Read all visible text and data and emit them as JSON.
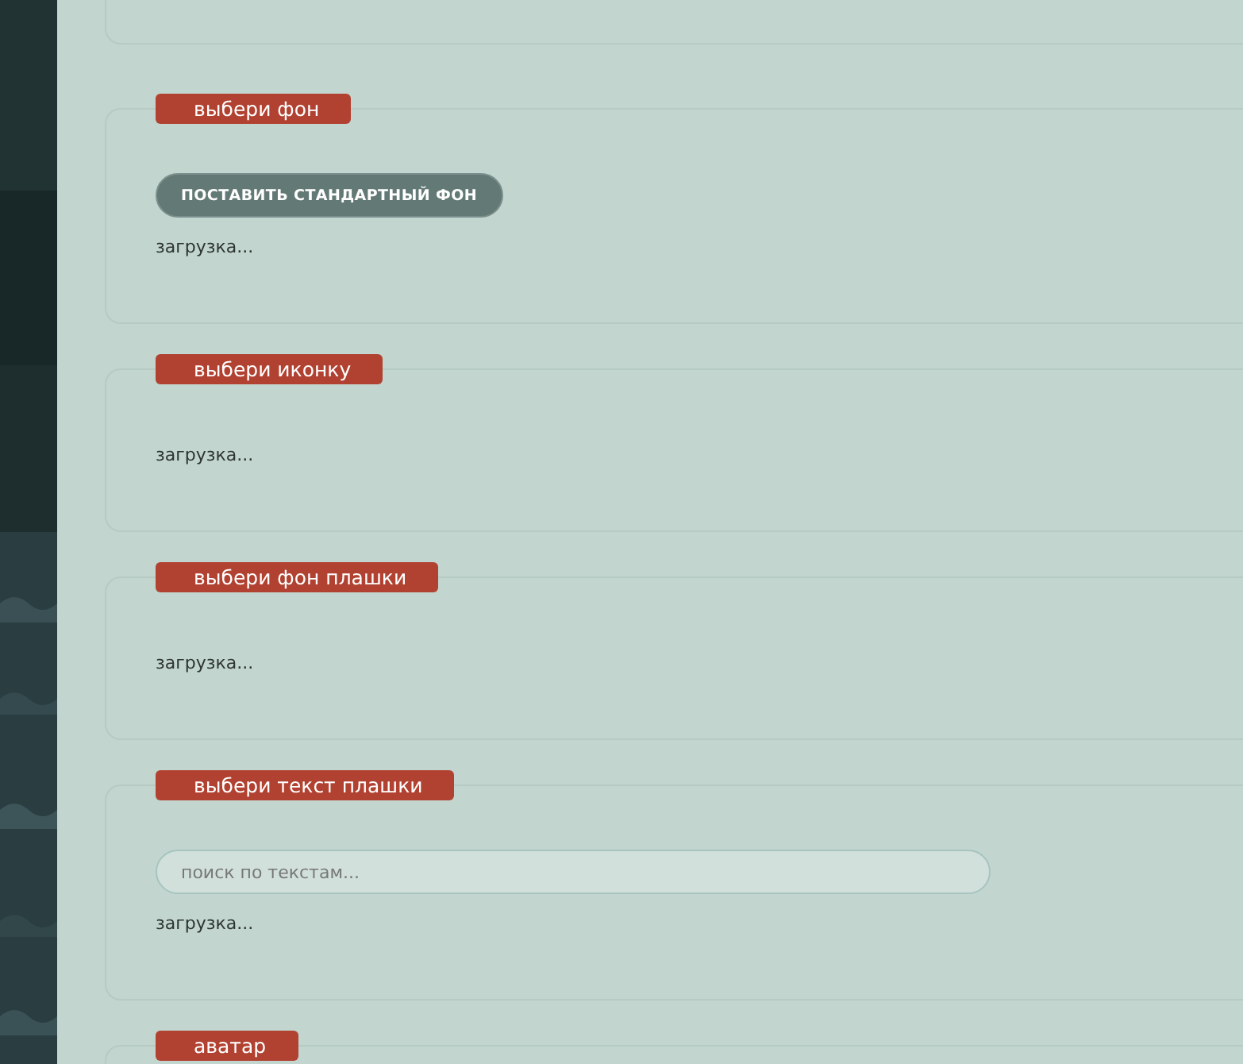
{
  "sections": [
    {
      "legend": "выбери фон",
      "items": [
        {
          "kind": "button",
          "label": "ПОСТАВИТЬ СТАНДАРТНЫЙ ФОН"
        },
        {
          "kind": "status",
          "text": "загрузка..."
        }
      ]
    },
    {
      "legend": "выбери иконку",
      "items": [
        {
          "kind": "status",
          "text": "загрузка..."
        }
      ]
    },
    {
      "legend": "выбери фон плашки",
      "items": [
        {
          "kind": "status",
          "text": "загрузка..."
        }
      ]
    },
    {
      "legend": "выбери текст плашки",
      "items": [
        {
          "kind": "field",
          "placeholder": "поиск по текстам..."
        },
        {
          "kind": "status",
          "text": "загрузка..."
        }
      ]
    },
    {
      "legend": "аватар"
    }
  ]
}
